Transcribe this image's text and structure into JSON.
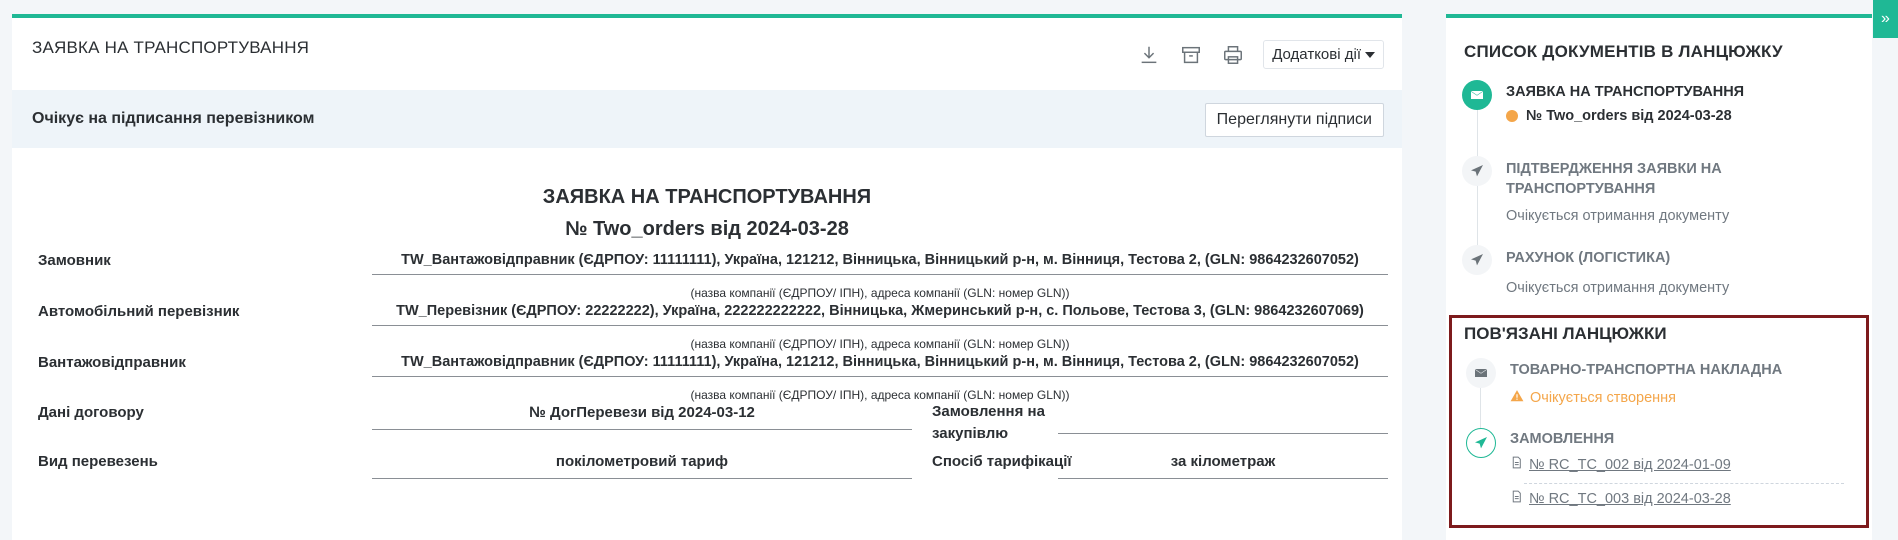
{
  "header": {
    "title": "ЗАЯВКА НА ТРАНСПОРТУВАННЯ",
    "actions_label": "Додаткові дії",
    "icons": [
      "download-icon",
      "archive-icon",
      "print-icon"
    ]
  },
  "status": {
    "text": "Очікує на підписання перевізником",
    "view_signatures_label": "Переглянути підписи"
  },
  "document": {
    "title": "ЗАЯВКА НА ТРАНСПОРТУВАННЯ",
    "number_line": "№ Two_orders від 2024-03-28",
    "hint": "(назва компанії (ЄДРПОУ/ ІПН), адреса компанії (GLN: номер GLN))",
    "rows": [
      {
        "label": "Замовник",
        "value": "TW_Вантажовідправник (ЄДРПОУ: 11111111), Україна, 121212, Вінницька, Вінницький р-н, м. Вінниця, Тестова 2, (GLN: 9864232607052)"
      },
      {
        "label": "Автомобільний перевізник",
        "value": "TW_Перевізник (ЄДРПОУ: 22222222), Україна, 222222222222, Вінницька, Жмеринський р-н, с. Польове, Тестова 3, (GLN: 9864232607069)"
      },
      {
        "label": "Вантажовідправник",
        "value": "TW_Вантажовідправник (ЄДРПОУ: 11111111), Україна, 121212, Вінницька, Вінницький р-н, м. Вінниця, Тестова 2, (GLN: 9864232607052)"
      }
    ],
    "contract": {
      "label": "Дані договору",
      "value": "№ ДогПеревези від 2024-03-12",
      "order_label_line1": "Замовлення на",
      "order_label_line2": "закупівлю",
      "order_value": ""
    },
    "transport": {
      "label": "Вид перевезень",
      "value": "покілометровий тариф",
      "billing_label": "Спосіб тарифікації",
      "billing_value": "за кілометраж"
    }
  },
  "sidebar": {
    "title": "СПИСОК ДОКУМЕНТІВ В ЛАНЦЮЖКУ",
    "items": [
      {
        "name": "ЗАЯВКА НА ТРАНСПОРТУВАННЯ",
        "doc": "№ Two_orders від 2024-03-28"
      },
      {
        "name_line1": "ПІДТВЕРДЖЕННЯ ЗАЯВКИ НА",
        "name_line2": "ТРАНСПОРТУВАННЯ",
        "sub": "Очікується отримання документу"
      },
      {
        "name": "РАХУНОК (ЛОГІСТИКА)",
        "sub": "Очікується отримання документу"
      }
    ],
    "related": {
      "title": "ПОВ'ЯЗАНІ ЛАНЦЮЖКИ",
      "items": [
        {
          "name": "ТОВАРНО-ТРАНСПОРТНА НАКЛАДНА",
          "warning": "Очікується створення"
        },
        {
          "name": "ЗАМОВЛЕННЯ",
          "links": [
            "№ RC_TC_002 від 2024-01-09",
            "№ RC_TC_003 від 2024-03-28"
          ]
        }
      ]
    },
    "collapse_label": "»"
  },
  "colors": {
    "accent": "#1fb895",
    "warning": "#f4a64a",
    "highlight_border": "#7d1a1c"
  }
}
